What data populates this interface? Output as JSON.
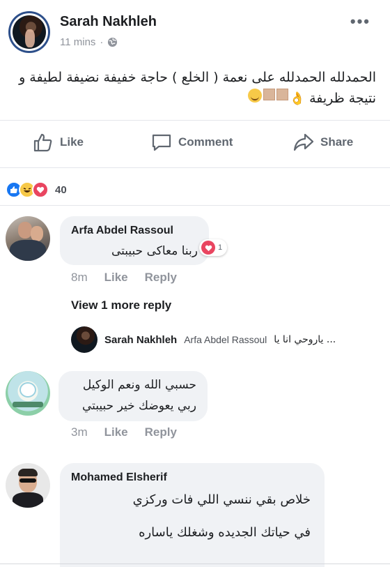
{
  "post": {
    "author": "Sarah Nakhleh",
    "time": "11 mins",
    "dot": "·",
    "more": "•••",
    "text": "الحمدلله الحمدلله على نعمة ( الخلع ) حاجة خفيفة نضيفة لطيفة و نتيجة ظريفة",
    "emoji_hand": "👌"
  },
  "actions": {
    "like": "Like",
    "comment": "Comment",
    "share": "Share"
  },
  "reactions": {
    "count": "40"
  },
  "comments": [
    {
      "author": "Arfa Abdel Rassoul",
      "text": "ربنا معاكى حبيبتى",
      "time": "8m",
      "like": "Like",
      "reply": "Reply",
      "reaction_count": "1"
    },
    {
      "author": "",
      "text_line1": "حسبي الله ونعم الوكيل",
      "text_line2": "ربي يعوضك خير حبيبتي",
      "time": "3m",
      "like": "Like",
      "reply": "Reply"
    },
    {
      "author": "Mohamed Elsherif",
      "text_line1": "خلاص بقي ننسي اللي فات وركزي",
      "text_line2": "في حياتك الجديده وشغلك ياساره"
    }
  ],
  "view_more": "View 1 more reply",
  "reply_preview": {
    "author": "Sarah Nakhleh",
    "mention": "Arfa Abdel Rassoul",
    "text": "... ياروحي انا يا"
  },
  "colors": {
    "like_blue": "#1877f2",
    "love_red": "#e94560",
    "haha_yellow": "#f7c948",
    "muted_text": "#90949c"
  }
}
